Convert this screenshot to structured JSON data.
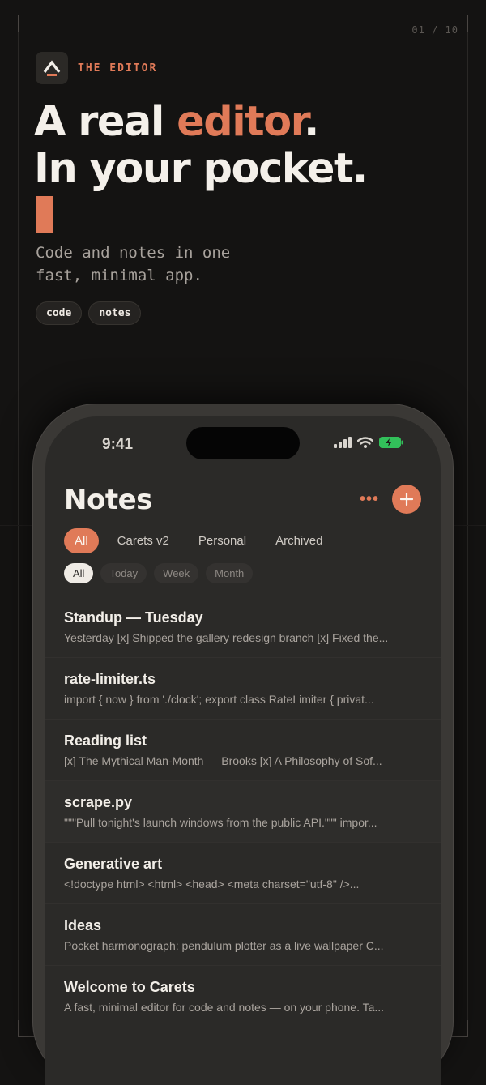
{
  "page_counter": "01 / 10",
  "brand": {
    "name": "THE EDITOR",
    "logo_icon": "caret-logo-icon"
  },
  "headline": {
    "line1_pre": "A real ",
    "line1_accent": "editor",
    "line1_post": ".",
    "line2": "In your pocket."
  },
  "subtitle": "Code and notes in one fast, minimal app.",
  "tags": [
    "code",
    "notes"
  ],
  "colors": {
    "accent": "#e07a58",
    "background": "#141312",
    "screen": "#2b2a28"
  },
  "phone": {
    "status": {
      "time": "9:41"
    },
    "header": {
      "title": "Notes",
      "more_icon": "more-icon",
      "add_icon": "plus-icon"
    },
    "folders": [
      "All",
      "Carets v2",
      "Personal",
      "Archived"
    ],
    "active_folder": "All",
    "time_filters": [
      "All",
      "Today",
      "Week",
      "Month"
    ],
    "active_time_filter": "All",
    "notes": [
      {
        "title": "Standup — Tuesday",
        "preview": "Yesterday  [x] Shipped the gallery redesign branch  [x] Fixed the..."
      },
      {
        "title": "rate-limiter.ts",
        "preview": "import { now } from './clock';  export class RateLimiter {  privat..."
      },
      {
        "title": "Reading list",
        "preview": "[x] The Mythical Man-Month — Brooks  [x] A Philosophy of Sof..."
      },
      {
        "title": "scrape.py",
        "preview": "\"\"\"Pull tonight's launch windows from the public API.\"\"\"  impor..."
      },
      {
        "title": "Generative art",
        "preview": "<!doctype html>  <html>  <head>  <meta charset=\"utf-8\" />..."
      },
      {
        "title": "Ideas",
        "preview": "Pocket harmonograph: pendulum plotter as a live wallpaper  C..."
      },
      {
        "title": "Welcome to Carets",
        "preview": "A fast, minimal editor for code and notes — on your phone.  Ta..."
      }
    ]
  }
}
